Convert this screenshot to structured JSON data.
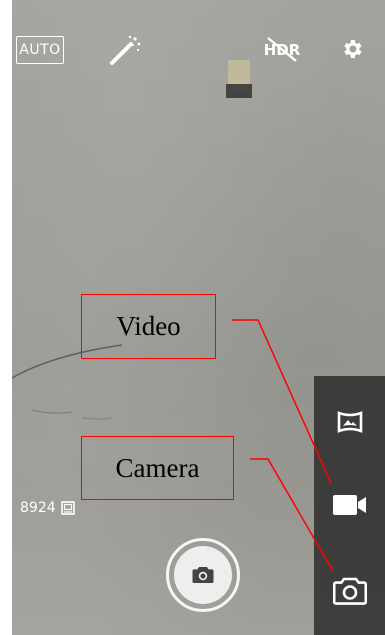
{
  "top_bar": {
    "scene_mode_label": "AUTO",
    "icons": [
      "magic-wand-icon",
      "hdr-off-icon",
      "gear-icon"
    ]
  },
  "mode_rail": {
    "items": [
      {
        "icon": "panorama-icon"
      },
      {
        "icon": "video-camera-icon"
      },
      {
        "icon": "camera-icon"
      }
    ]
  },
  "status": {
    "remaining_count": "8924",
    "icon": "gallery-icon"
  },
  "shutter": {
    "icon": "camera-icon"
  },
  "annotations": {
    "video_label": "Video",
    "camera_label": "Camera",
    "color": "#ff0000"
  },
  "colors": {
    "viewfinder": "#9d9e98",
    "rail": "#282828",
    "icon": "#ffffff"
  }
}
